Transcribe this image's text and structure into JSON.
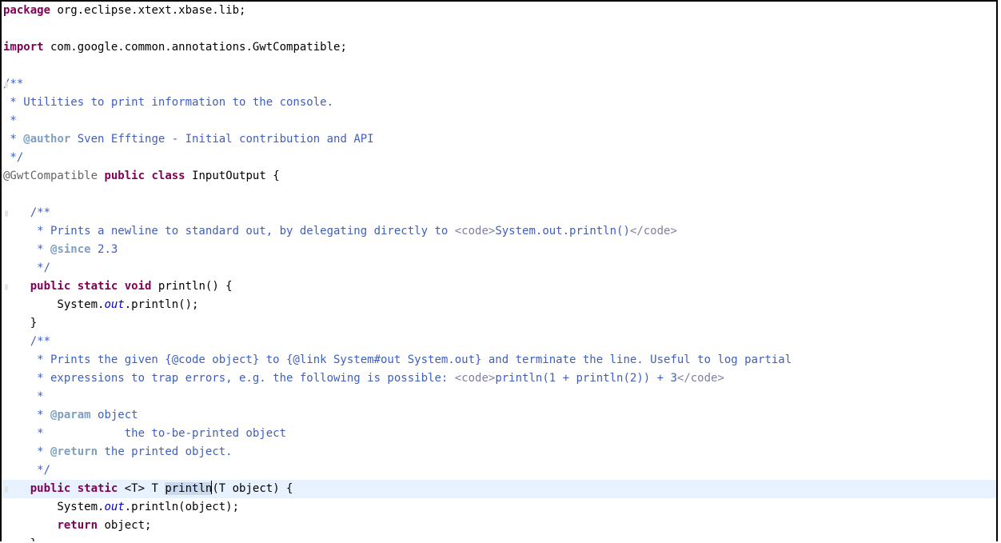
{
  "editor": {
    "l1": {
      "kw": "package",
      "rest": " org.eclipse.xtext.xbase.lib;"
    },
    "l3": {
      "kw": "import",
      "rest": " com.google.common.annotations.GwtCompatible;"
    },
    "l5": "/**",
    "l6": " * Utilities to print information to the console.",
    "l7": " *",
    "l8": {
      "pre": " * ",
      "tag": "@author",
      "rest": " Sven Efftinge - Initial contribution and API"
    },
    "l9": " */",
    "l10": {
      "anno": "@GwtCompatible",
      "k1": "public",
      "sp1": " ",
      "k2": "class",
      "rest": " InputOutput {"
    },
    "l12": "    /**",
    "l13": {
      "pre": "     * Prints a newline to standard out, by delegating directly to ",
      "t1": "<code>",
      "mid": "System.out.println()",
      "t2": "</code>"
    },
    "l14": {
      "pre": "     * ",
      "tag": "@since",
      "rest": " 2.3"
    },
    "l15": "     */",
    "l16": {
      "ind": "    ",
      "k1": "public",
      "s1": " ",
      "k2": "static",
      "s2": " ",
      "k3": "void",
      "rest": " println() {"
    },
    "l17": {
      "pre": "        System.",
      "field": "out",
      "rest": ".println();"
    },
    "l18": "    }",
    "l19": "    /**",
    "l20": "     * Prints the given {@code object} to {@link System#out System.out} and terminate the line. Useful to log partial",
    "l21": {
      "pre": "     * expressions to trap errors, e.g. the following is possible: ",
      "t1": "<code>",
      "mid": "println(1 + println(2)) + 3",
      "t2": "</code>"
    },
    "l22": "     *",
    "l23": {
      "pre": "     * ",
      "tag": "@param",
      "rest": " object"
    },
    "l24": "     *            the to-be-printed object",
    "l25": {
      "pre": "     * ",
      "tag": "@return",
      "rest": " the printed object."
    },
    "l26": "     */",
    "l27": {
      "ind": "    ",
      "k1": "public",
      "s1": " ",
      "k2": "static",
      "mid1": " <T> T ",
      "sel": "println",
      "rest": "(T object) {"
    },
    "l28": {
      "pre": "        System.",
      "field": "out",
      "rest": ".println(object);"
    },
    "l29": {
      "ind": "        ",
      "kw": "return",
      "rest": " object;"
    },
    "l30": "    }"
  }
}
